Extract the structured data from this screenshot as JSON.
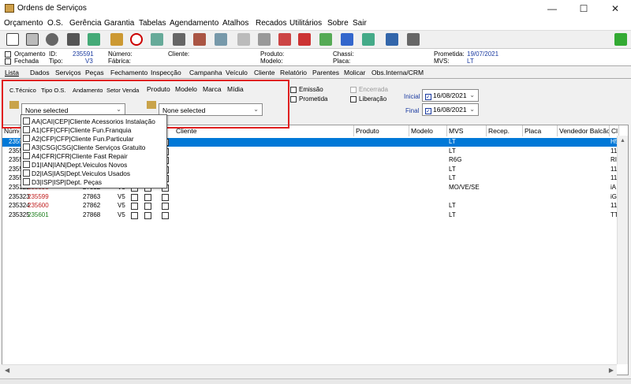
{
  "window": {
    "title": "Ordens de Serviços"
  },
  "menu": [
    "Orçamento",
    "O.S.",
    "Gerência",
    "Garantia",
    "Tabelas",
    "Agendamento",
    "Atalhos",
    "Recados",
    "Utilitários",
    "Sobre",
    "Sair"
  ],
  "info": {
    "orcamento_label": "Orçamento",
    "fechada_label": "Fechada",
    "id_label": "ID:",
    "id_value": "235591",
    "tipo_label": "Tipo:",
    "tipo_value": "V3",
    "numero_label": "Número:",
    "fabrica_label": "Fábrica:",
    "cliente_label": "Cliente:",
    "produto_label": "Produto:",
    "modelo_label": "Modelo:",
    "chassi_label": "Chassi:",
    "placa_label": "Placa:",
    "prometida_label": "Prometida:",
    "prometida_value": "19/07/2021",
    "mvs_label": "MVS:",
    "mvs_value": "LT"
  },
  "tabs": [
    "Lista",
    "Dados",
    "Serviços",
    "Peças",
    "Fechamento",
    "Inspecção",
    "Campanha",
    "Veículo",
    "Cliente",
    "Relatório",
    "Parentes",
    "Molicar",
    "Obs.Interna/CRM"
  ],
  "left_tabs": [
    "C.Técnico",
    "Tipo O.S.",
    "Andamento",
    "Setor Venda"
  ],
  "product_tabs": [
    "Produto",
    "Modelo",
    "Marca",
    "Mídia"
  ],
  "filter": {
    "left_select": "None selected",
    "right_select": "None selected",
    "emissao": "Emissão",
    "prometida": "Prometida",
    "encerrada": "Encerrada",
    "liberacao": "Liberação",
    "inicial_label": "Inicial",
    "inicial_date": "16/08/2021",
    "final_label": "Final",
    "final_date": "16/08/2021"
  },
  "dropdown_items": [
    "AA|CAI|CEP|Cliente Acessorios Instalação",
    "A1|CFF|CFF|Cliente Fun.Franquia",
    "A2|CFP|CFP|Cliente Fun.Particular",
    "A3|CSG|CSG|Cliente Serviços Gratuito",
    "A4|CFR|CFR|Cliente Fast Repair",
    "D1|IAN|IAN|Dept.Veiculos Novos",
    "D2|IAS|IAS|Dept.Veiculos Usados",
    "D3|ISP|ISP|Dept. Peças"
  ],
  "grid": {
    "headers": {
      "num": "Núme",
      "cliente": "Cliente",
      "produto": "Produto",
      "modelo": "Modelo",
      "mvs": "MVS",
      "recep": "Recep.",
      "placa": "Placa",
      "vend": "Vendedor Balcão",
      "cl": "Cl"
    },
    "rows": [
      {
        "num": "2355",
        "os": "",
        "n2": "",
        "tp": "",
        "mvs": "LT",
        "cl": "H5"
      },
      {
        "num": "2355",
        "os": "",
        "n2": "",
        "tp": "",
        "mvs": "LT",
        "cl": "11"
      },
      {
        "num": "2355",
        "os": "",
        "n2": "",
        "tp": "",
        "mvs": "R6G",
        "cl": "RI"
      },
      {
        "num": "2355",
        "os": "",
        "n2": "",
        "tp": "",
        "mvs": "LT",
        "cl": "11"
      },
      {
        "num": "2355",
        "os": "",
        "n2": "",
        "tp": "",
        "mvs": "LT",
        "cl": "11"
      },
      {
        "num": "235322",
        "os": "235598",
        "n2": "27832",
        "tp": "V5",
        "mvs": "MO/VE/SE",
        "cl": "iA"
      },
      {
        "num": "235323",
        "os": "235599",
        "n2": "27863",
        "tp": "V5",
        "mvs": "",
        "cl": "iG"
      },
      {
        "num": "235324",
        "os": "235600",
        "n2": "27862",
        "tp": "V5",
        "mvs": "LT",
        "cl": "11"
      },
      {
        "num": "235325",
        "os": "235601",
        "n2": "27868",
        "tp": "V5",
        "mvs": "LT",
        "cl": "TT"
      }
    ]
  }
}
